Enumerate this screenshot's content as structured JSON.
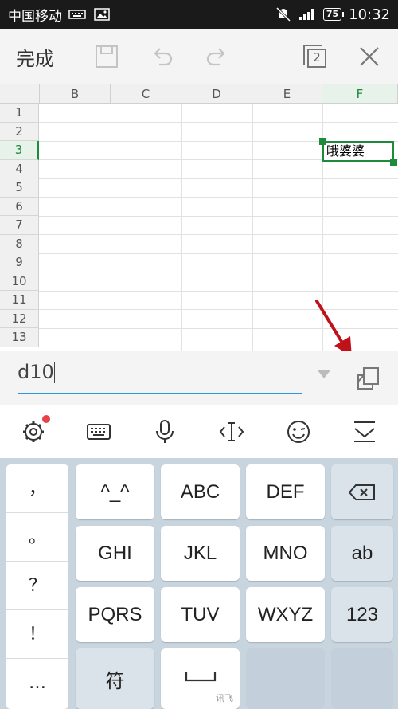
{
  "status_bar": {
    "carrier": "中国移动",
    "battery": "75",
    "time": "10:32"
  },
  "toolbar": {
    "done_label": "完成",
    "sheet_count": "2"
  },
  "sheet": {
    "columns": [
      "B",
      "C",
      "D",
      "E",
      "F"
    ],
    "active_column": "F",
    "rows": [
      "1",
      "2",
      "3",
      "4",
      "5",
      "6",
      "7",
      "8",
      "9",
      "10",
      "11",
      "12",
      "13"
    ],
    "active_row": "3",
    "active_cell_text": "哦婆婆"
  },
  "input_bar": {
    "value": "d10"
  },
  "keyboard": {
    "punctuation": [
      "，",
      "。",
      "？",
      "！",
      "…"
    ],
    "keys": {
      "k1": "^_^",
      "k2": "ABC",
      "k3": "DEF",
      "k4": "GHI",
      "k5": "JKL",
      "k6": "MNO",
      "k7": "PQRS",
      "k8": "TUV",
      "k9": "WXYZ",
      "ab": "ab",
      "num": "123",
      "symbol": "符",
      "space_brand": "讯飞"
    }
  },
  "colors": {
    "accent_green": "#1e8a3c",
    "input_underline": "#2a9bd8",
    "annotation_arrow": "#c0111b",
    "notification_dot": "#e8414a"
  }
}
